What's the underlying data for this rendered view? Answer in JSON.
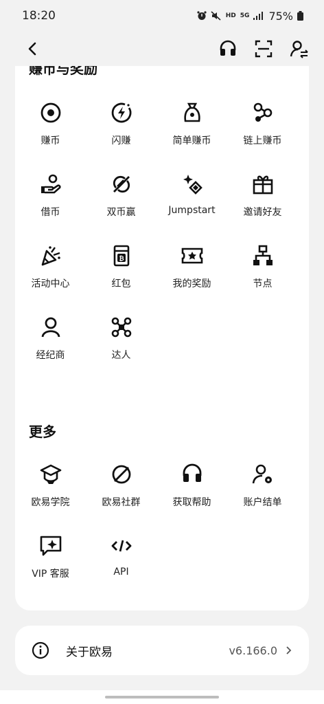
{
  "status": {
    "time": "18:20",
    "battery": "75%",
    "hd": "HD",
    "net": "5G"
  },
  "rewards": {
    "title": "赚币与奖励",
    "items": [
      {
        "label": "赚币",
        "icon": "coin-icon"
      },
      {
        "label": "闪赚",
        "icon": "flash-icon"
      },
      {
        "label": "简单赚币",
        "icon": "money-bag-icon"
      },
      {
        "label": "链上赚币",
        "icon": "chain-nodes-icon"
      },
      {
        "label": "借币",
        "icon": "hand-coin-icon"
      },
      {
        "label": "双币赢",
        "icon": "dual-coin-icon"
      },
      {
        "label": "Jumpstart",
        "icon": "sparkle-rocket-icon"
      },
      {
        "label": "邀请好友",
        "icon": "gift-icon"
      },
      {
        "label": "活动中心",
        "icon": "party-popper-icon"
      },
      {
        "label": "红包",
        "icon": "red-packet-icon"
      },
      {
        "label": "我的奖励",
        "icon": "ticket-star-icon"
      },
      {
        "label": "节点",
        "icon": "node-tree-icon"
      },
      {
        "label": "经纪商",
        "icon": "user-icon"
      },
      {
        "label": "达人",
        "icon": "network-icon"
      }
    ]
  },
  "more": {
    "title": "更多",
    "items": [
      {
        "label": "欧易学院",
        "icon": "academy-cap-icon"
      },
      {
        "label": "欧易社群",
        "icon": "planet-icon"
      },
      {
        "label": "获取帮助",
        "icon": "headset-icon"
      },
      {
        "label": "账户结单",
        "icon": "user-settings-icon"
      },
      {
        "label": "VIP 客服",
        "icon": "vip-chat-icon"
      },
      {
        "label": "API",
        "icon": "code-icon"
      }
    ]
  },
  "about": {
    "label": "关于欧易",
    "version": "v6.166.0"
  }
}
